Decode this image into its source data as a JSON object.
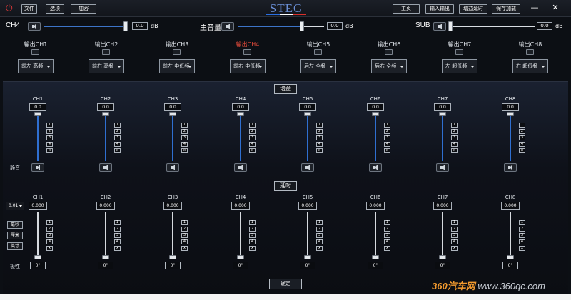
{
  "topbar": {
    "menu": [
      "文件",
      "选项",
      "加密"
    ],
    "logo": "STEG",
    "logo_colors": [
      "#2b6fe0",
      "#ffffff",
      "#d9302b"
    ],
    "nav": [
      "主页",
      "输入输出",
      "增益延时",
      "保存加载"
    ],
    "win_min": "—",
    "win_close": "✕"
  },
  "master": {
    "ch4": {
      "label": "CH4",
      "value": "0.0",
      "unit": "dB"
    },
    "main": {
      "label": "主音量",
      "value": "0.0",
      "unit": "dB"
    },
    "sub": {
      "label": "SUB",
      "value": "0.0",
      "unit": "dB"
    }
  },
  "outputs": [
    {
      "name": "输出CH1",
      "select": "前左 高频",
      "active": false
    },
    {
      "name": "输出CH2",
      "select": "前右 高频",
      "active": false
    },
    {
      "name": "输出CH3",
      "select": "前左 中低频",
      "active": false
    },
    {
      "name": "输出CH4",
      "select": "前右 中低频",
      "active": true
    },
    {
      "name": "输出CH5",
      "select": "后左 全频",
      "active": false
    },
    {
      "name": "输出CH6",
      "select": "后右 全频",
      "active": false
    },
    {
      "name": "输出CH7",
      "select": "左 超低频",
      "active": false
    },
    {
      "name": "输出CH8",
      "select": "右 超低频",
      "active": false
    }
  ],
  "gain": {
    "title": "增益",
    "mute_label": "静音",
    "channels": [
      "CH1",
      "CH2",
      "CH3",
      "CH4",
      "CH5",
      "CH6",
      "CH7",
      "CH8"
    ],
    "values": [
      "0.0",
      "0.0",
      "0.0",
      "0.0",
      "0.0",
      "0.0",
      "0.0",
      "0.0"
    ],
    "presets": [
      "1",
      "2",
      "3",
      "4",
      "x"
    ]
  },
  "delay": {
    "title": "延时",
    "step": "0.01",
    "units": [
      "毫秒",
      "厘米",
      "英寸"
    ],
    "channels": [
      "CH1",
      "CH2",
      "CH3",
      "CH4",
      "CH5",
      "CH6",
      "CH7",
      "CH8"
    ],
    "values": [
      "0.000",
      "0.000",
      "0.000",
      "0.000",
      "0.000",
      "0.000",
      "0.000",
      "0.000"
    ],
    "presets": [
      "1",
      "2",
      "3",
      "4",
      "x"
    ],
    "polarity_label": "极性",
    "polarity": [
      "0°",
      "0°",
      "0°",
      "0°",
      "0°",
      "0°",
      "0°",
      "0°"
    ]
  },
  "confirm_label": "确定",
  "watermark": {
    "brand": "360汽车网",
    "url": "www.360qc.com"
  }
}
